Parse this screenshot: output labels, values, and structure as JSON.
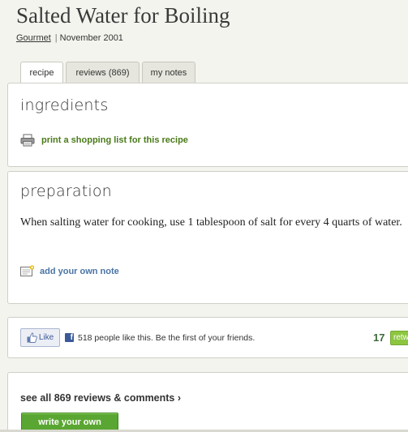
{
  "recipe": {
    "title": "Salted Water for Boiling",
    "source": "Gourmet",
    "separator": "|",
    "date": "November 2001"
  },
  "tabs": [
    {
      "label": "recipe",
      "active": true
    },
    {
      "label": "reviews (869)",
      "active": false
    },
    {
      "label": "my notes",
      "active": false
    }
  ],
  "ingredients": {
    "heading": "ingredients",
    "print_link": "print a shopping list for this recipe",
    "print_icon": "printer-icon"
  },
  "preparation": {
    "heading": "preparation",
    "text": "When salting water for cooking, use 1 tablespoon of salt for every 4 quarts of water.",
    "note_link": "add your own note",
    "note_icon": "add-note-icon"
  },
  "social": {
    "like_label": "Like",
    "fb_text": "518 people like this. Be the first of your friends.",
    "tweet_count": "17",
    "tweet_label": "retweet",
    "like_icon": "thumbs-up-icon",
    "fb_icon": "facebook-icon"
  },
  "reviews": {
    "see_all": "see all 869 reviews & comments ›",
    "write_button": "write your own"
  },
  "colors": {
    "background": "#f4f4ef",
    "link_green": "#4a7a1a",
    "link_blue": "#4a74a6",
    "button_green": "#5aa632",
    "facebook_blue": "#3b5998"
  }
}
